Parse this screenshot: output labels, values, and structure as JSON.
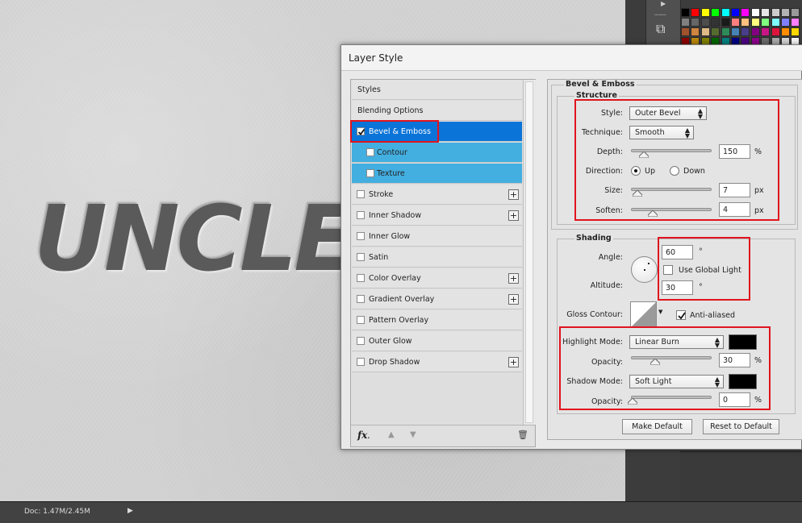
{
  "canvas": {
    "text": "UNCLE"
  },
  "status": {
    "doc": "Doc: 1.47M/2.45M"
  },
  "dialog": {
    "title": "Layer Style",
    "list": [
      {
        "label": "Styles"
      },
      {
        "label": "Blending Options"
      },
      {
        "label": "Bevel & Emboss",
        "checked": true
      },
      {
        "label": "Contour",
        "checked": false
      },
      {
        "label": "Texture",
        "checked": false
      },
      {
        "label": "Stroke",
        "checked": false
      },
      {
        "label": "Inner Shadow",
        "checked": false
      },
      {
        "label": "Inner Glow",
        "checked": false
      },
      {
        "label": "Satin",
        "checked": false
      },
      {
        "label": "Color Overlay",
        "checked": false
      },
      {
        "label": "Gradient Overlay",
        "checked": false
      },
      {
        "label": "Pattern Overlay",
        "checked": false
      },
      {
        "label": "Outer Glow",
        "checked": false
      },
      {
        "label": "Drop Shadow",
        "checked": false
      }
    ],
    "footer": {
      "fx": "fx",
      "fx_sub": "."
    },
    "bevel": {
      "title": "Bevel & Emboss",
      "structure_title": "Structure",
      "style_label": "Style:",
      "style_value": "Outer Bevel",
      "technique_label": "Technique:",
      "technique_value": "Smooth",
      "depth_label": "Depth:",
      "depth_value": "150",
      "depth_unit": "%",
      "direction_label": "Direction:",
      "direction_up": "Up",
      "direction_down": "Down",
      "size_label": "Size:",
      "size_value": "7",
      "size_unit": "px",
      "soften_label": "Soften:",
      "soften_value": "4",
      "soften_unit": "px",
      "shading_title": "Shading",
      "angle_label": "Angle:",
      "angle_value": "60",
      "angle_unit": "°",
      "global_light_label": "Use Global Light",
      "global_light_checked": false,
      "altitude_label": "Altitude:",
      "altitude_value": "30",
      "altitude_unit": "°",
      "gloss_label": "Gloss Contour:",
      "anti_aliased_label": "Anti-aliased",
      "anti_aliased_checked": true,
      "highlight_mode_label": "Highlight Mode:",
      "highlight_mode_value": "Linear Burn",
      "highlight_color": "#000000",
      "highlight_opacity_label": "Opacity:",
      "highlight_opacity_value": "30",
      "highlight_opacity_unit": "%",
      "shadow_mode_label": "Shadow Mode:",
      "shadow_mode_value": "Soft Light",
      "shadow_color": "#000000",
      "shadow_opacity_label": "Opacity:",
      "shadow_opacity_value": "0",
      "shadow_opacity_unit": "%",
      "make_default": "Make Default",
      "reset_default": "Reset to Default"
    }
  },
  "colors": {
    "accent": "#0a74d8",
    "sub_selected": "#43aee0",
    "highlight_box": "#e0141e"
  }
}
